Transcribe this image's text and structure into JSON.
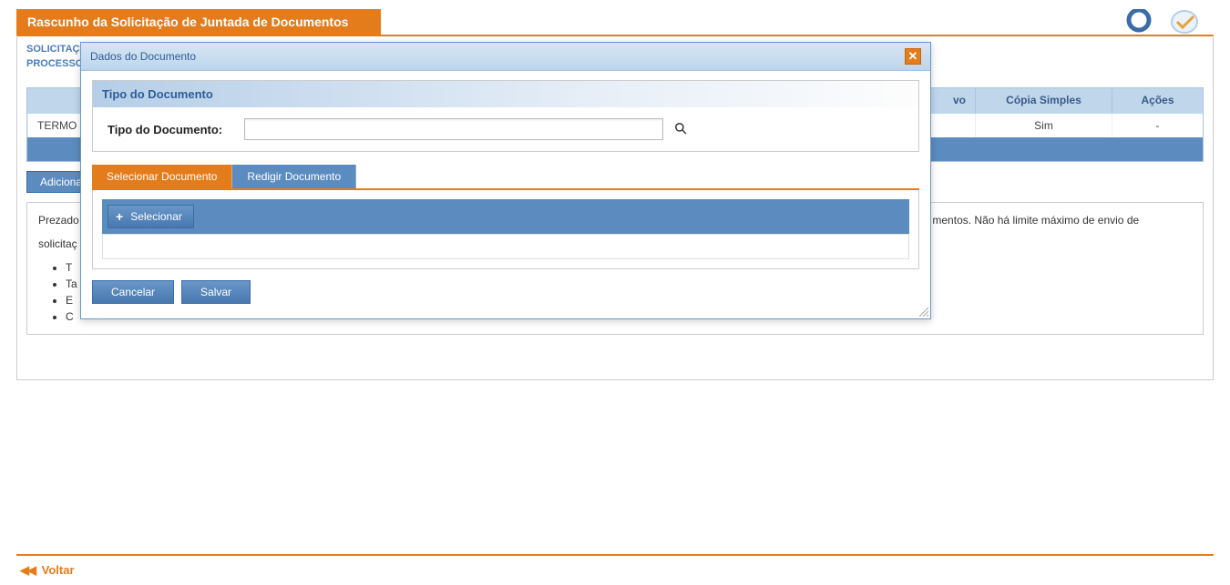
{
  "header": {
    "title": "Rascunho da Solicitação de Juntada de Documentos"
  },
  "sections": {
    "solicita": "SOLICITAÇ",
    "processo": "PROCESSO"
  },
  "table": {
    "cols": {
      "vo": "vo",
      "copia": "Cópia Simples",
      "acoes": "Ações"
    },
    "row": {
      "termo": "TERMO D",
      "copia": "Sim",
      "acoes": "-"
    }
  },
  "buttons": {
    "adicionar": "Adicionar"
  },
  "info": {
    "p1_prefix": "Prezado",
    "p1_suffix": "mentos. Não há limite máximo de envio de",
    "p2": "solicitaç",
    "li1": "T",
    "li2": "Ta",
    "li3": "E",
    "li4": "C"
  },
  "footer": {
    "voltar": "Voltar",
    "rewind": "◀◀"
  },
  "modal": {
    "title": "Dados do Documento",
    "close": "✕",
    "panel": {
      "header": "Tipo do Documento",
      "label": "Tipo do Documento:",
      "value": ""
    },
    "tabs": {
      "selecionar": "Selecionar Documento",
      "redigir": "Redigir Documento"
    },
    "selecionar_btn": "Selecionar",
    "plus": "+",
    "cancelar": "Cancelar",
    "salvar": "Salvar"
  }
}
